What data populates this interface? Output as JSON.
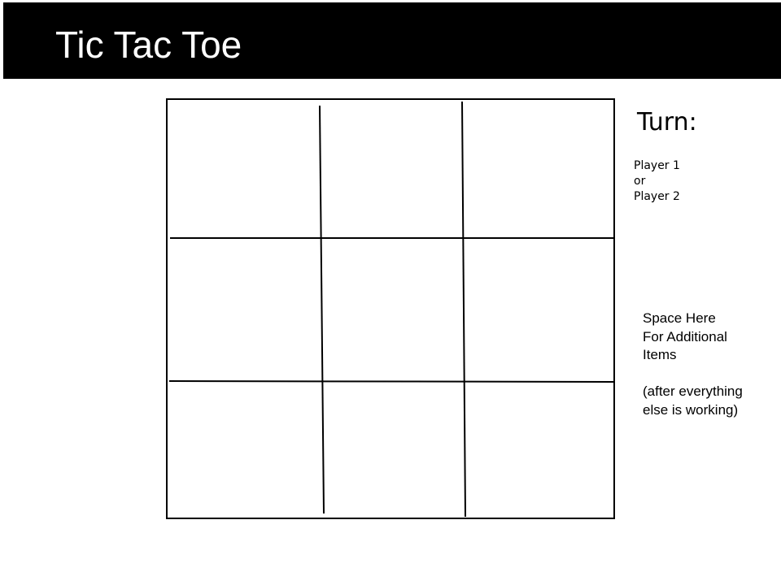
{
  "header": {
    "title": "Tic Tac Toe",
    "background": "#000000",
    "text_color": "#ffffff"
  },
  "board": {
    "rows": 3,
    "columns": 3,
    "cells": [
      "",
      "",
      "",
      "",
      "",
      "",
      "",
      "",
      ""
    ]
  },
  "turn": {
    "label": "Turn:",
    "lines": [
      "Player 1",
      "or",
      "Player 2"
    ]
  },
  "additional": {
    "lines": [
      "Space Here",
      "For Additional",
      "Items",
      "",
      "(after everything",
      "else is working)"
    ]
  }
}
